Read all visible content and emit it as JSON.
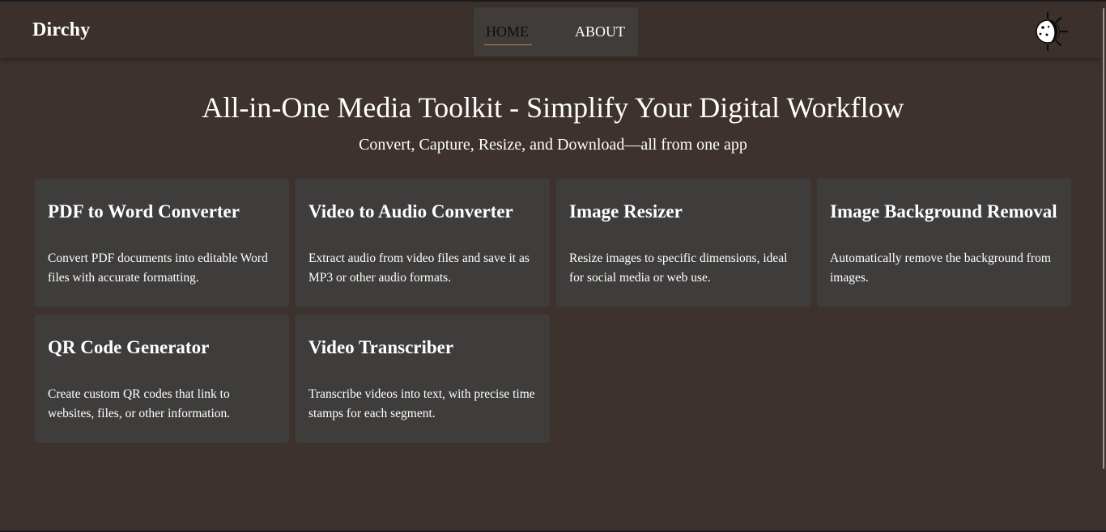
{
  "header": {
    "logo": "Dirchy",
    "nav": [
      {
        "label": "HOME",
        "active": true
      },
      {
        "label": "ABOUT",
        "active": false
      }
    ],
    "theme_toggle_icon": "moon-sun-toggle-icon"
  },
  "hero": {
    "title": "All-in-One Media Toolkit - Simplify Your Digital Workflow",
    "subtitle": "Convert, Capture, Resize, and Download—all from one app"
  },
  "tools": [
    {
      "title": "PDF to Word Converter",
      "description": "Convert PDF documents into editable Word files with accurate formatting."
    },
    {
      "title": "Video to Audio Converter",
      "description": "Extract audio from video files and save it as MP3 or other audio formats."
    },
    {
      "title": "Image Resizer",
      "description": "Resize images to specific dimensions, ideal for social media or web use."
    },
    {
      "title": "Image Background Removal",
      "description": "Automatically remove the background from images."
    },
    {
      "title": "QR Code Generator",
      "description": "Create custom QR codes that link to websites, files, or other information."
    },
    {
      "title": "Video Transcriber",
      "description": "Transcribe videos into text, with precise time stamps for each segment."
    }
  ],
  "colors": {
    "background": "#3d322d",
    "card": "#3f3d3c",
    "nav_bg": "#3f3c3a",
    "active_underline": "#b8864a"
  }
}
